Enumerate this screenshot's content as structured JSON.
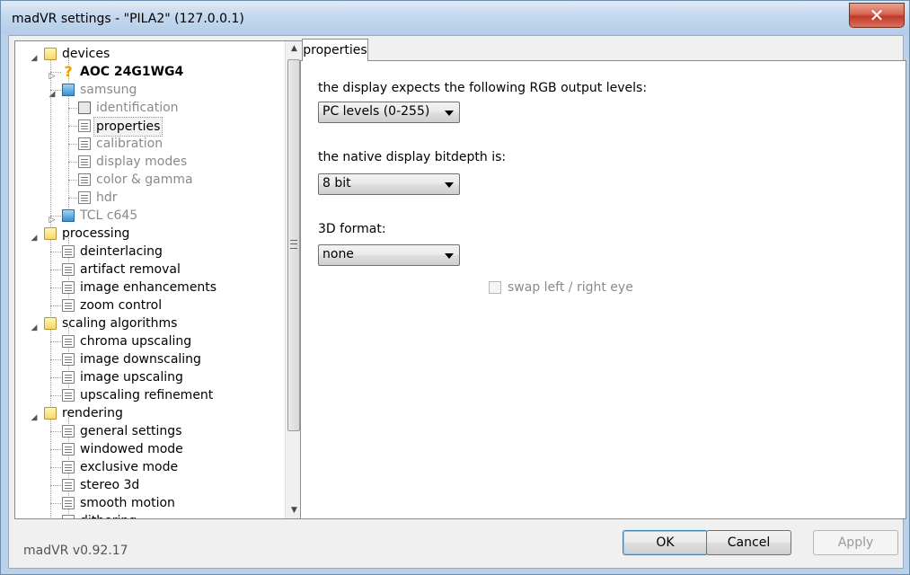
{
  "window": {
    "title": "madVR settings - \"PILA2\" (127.0.0.1)",
    "close_glyph": "✕"
  },
  "tree": {
    "items": [
      {
        "label": "devices",
        "icon": "folder-icon",
        "expander": "◢"
      },
      {
        "label": "AOC 24G1WG4",
        "icon": "question-icon",
        "icon_glyph": "?",
        "expander": "▷"
      },
      {
        "label": "samsung",
        "icon": "monitor-icon",
        "expander": "◢"
      },
      {
        "label": "identification",
        "icon": "id-card-icon"
      },
      {
        "label": "properties",
        "icon": "page-icon",
        "selected": true
      },
      {
        "label": "calibration",
        "icon": "page-icon"
      },
      {
        "label": "display modes",
        "icon": "page-icon"
      },
      {
        "label": "color & gamma",
        "icon": "page-icon"
      },
      {
        "label": "hdr",
        "icon": "page-icon"
      },
      {
        "label": "TCL c645",
        "icon": "monitor-icon",
        "expander": "▷"
      },
      {
        "label": "processing",
        "icon": "folder-icon",
        "expander": "◢"
      },
      {
        "label": "deinterlacing",
        "icon": "page-icon"
      },
      {
        "label": "artifact removal",
        "icon": "page-icon"
      },
      {
        "label": "image enhancements",
        "icon": "page-icon"
      },
      {
        "label": "zoom control",
        "icon": "page-icon"
      },
      {
        "label": "scaling algorithms",
        "icon": "folder-icon",
        "expander": "◢"
      },
      {
        "label": "chroma upscaling",
        "icon": "page-icon"
      },
      {
        "label": "image downscaling",
        "icon": "page-icon"
      },
      {
        "label": "image upscaling",
        "icon": "page-icon"
      },
      {
        "label": "upscaling refinement",
        "icon": "page-icon"
      },
      {
        "label": "rendering",
        "icon": "folder-icon",
        "expander": "◢"
      },
      {
        "label": "general settings",
        "icon": "page-icon"
      },
      {
        "label": "windowed mode",
        "icon": "page-icon"
      },
      {
        "label": "exclusive mode",
        "icon": "page-icon"
      },
      {
        "label": "stereo 3d",
        "icon": "page-icon"
      },
      {
        "label": "smooth motion",
        "icon": "page-icon"
      },
      {
        "label": "dithering",
        "icon": "page-icon"
      }
    ],
    "scroll_up_glyph": "▲",
    "scroll_down_glyph": "▼"
  },
  "tab": {
    "label": "properties"
  },
  "properties": {
    "rgb_levels_label": "the display expects the following RGB output levels:",
    "rgb_levels_value": "PC levels (0-255)",
    "bitdepth_label": "the native display bitdepth is:",
    "bitdepth_value": "8 bit",
    "format3d_label": "3D format:",
    "format3d_value": "none",
    "swap_eye_label": "swap left / right eye"
  },
  "footer": {
    "version": "madVR v0.92.17",
    "ok_label": "OK",
    "cancel_label": "Cancel",
    "apply_label": "Apply"
  },
  "colors": {
    "title_bar": "#c4d8ee",
    "close_button": "#c0392b",
    "disabled_text": "#8a8a8a"
  }
}
